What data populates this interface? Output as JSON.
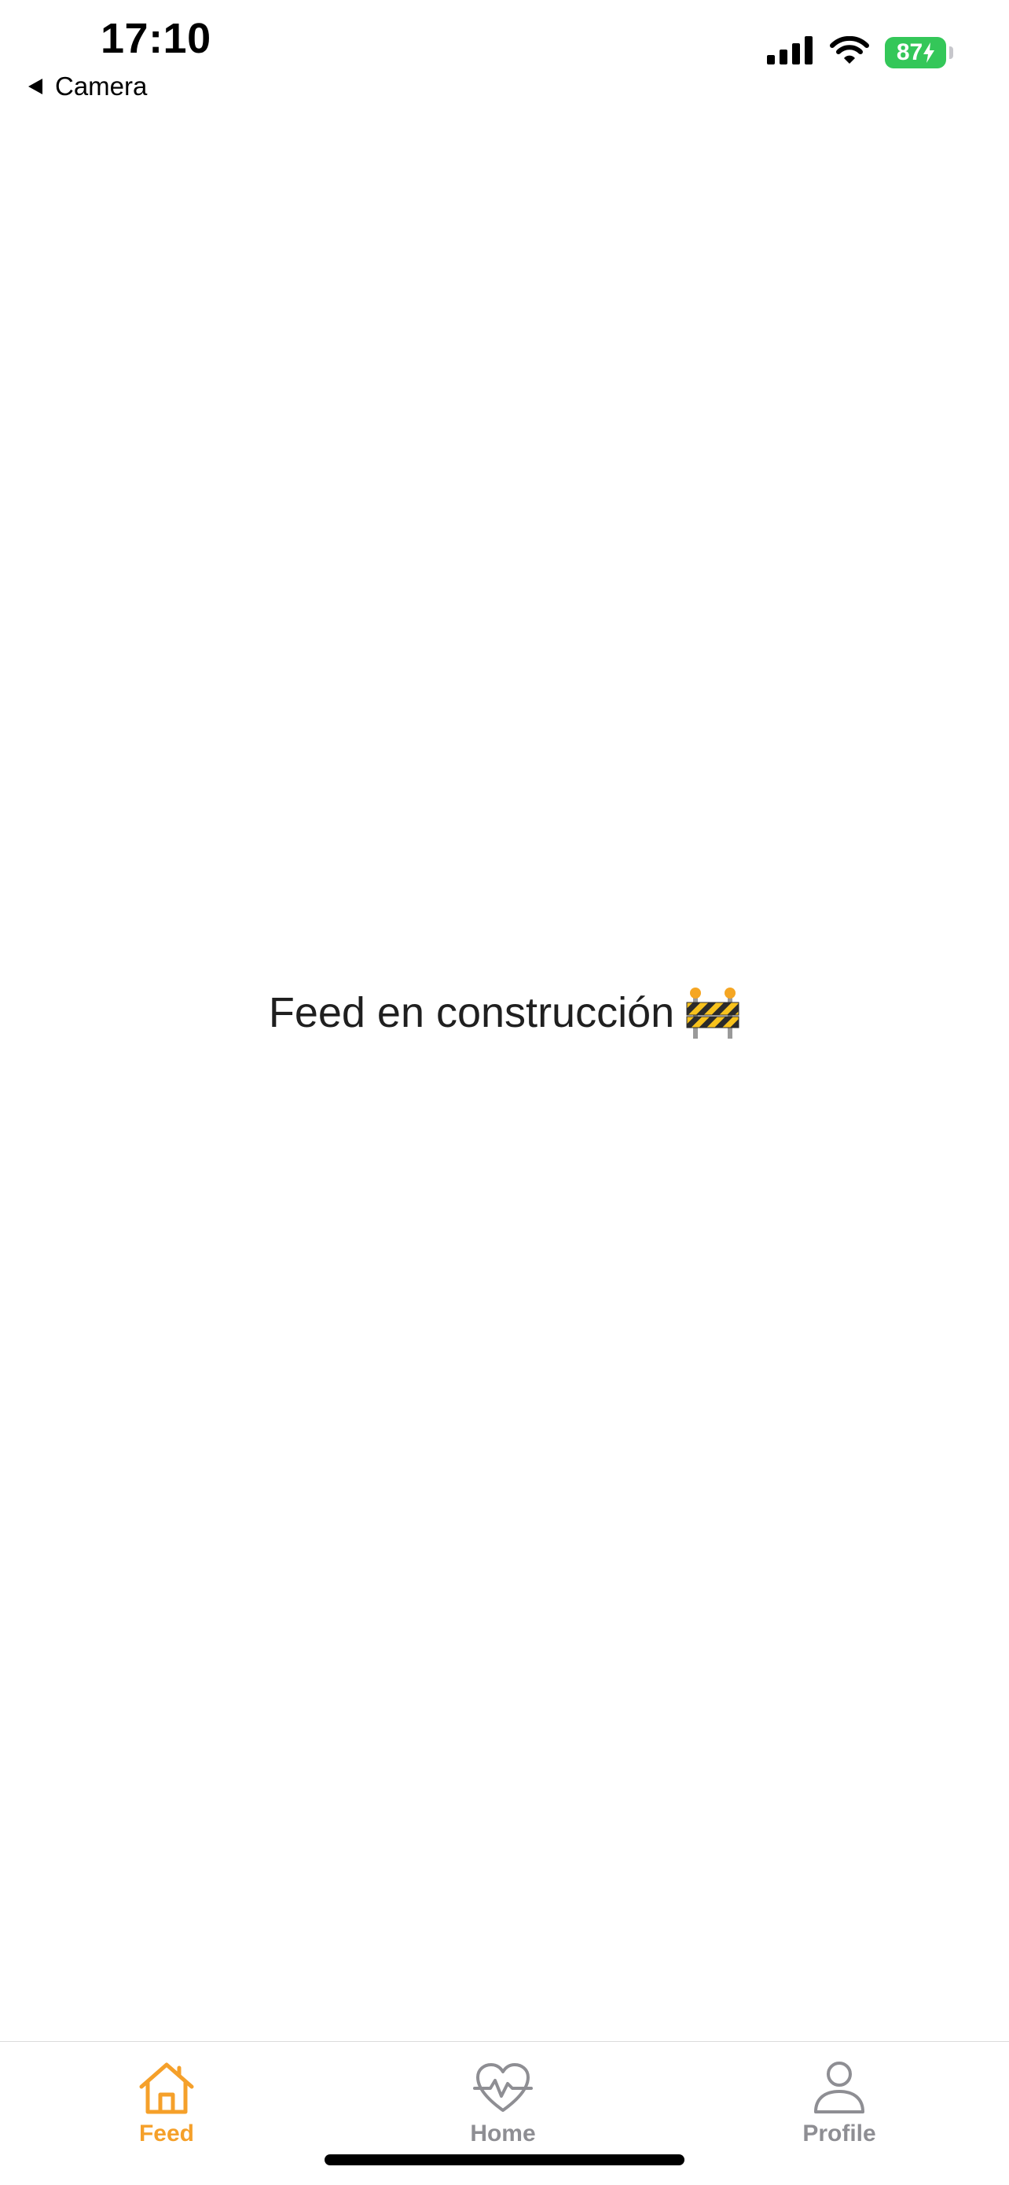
{
  "status_bar": {
    "time": "17:10",
    "back_label": "Camera",
    "battery": "87"
  },
  "main": {
    "message": "Feed en construcción",
    "message_icon": "construction-icon"
  },
  "tab_bar": {
    "tabs": [
      {
        "label": "Feed",
        "icon": "house-icon",
        "active": true
      },
      {
        "label": "Home",
        "icon": "heart-pulse-icon",
        "active": false
      },
      {
        "label": "Profile",
        "icon": "person-icon",
        "active": false
      }
    ]
  },
  "colors": {
    "accent": "#f5a02a",
    "inactive": "#8e8e93",
    "battery": "#34c759"
  }
}
